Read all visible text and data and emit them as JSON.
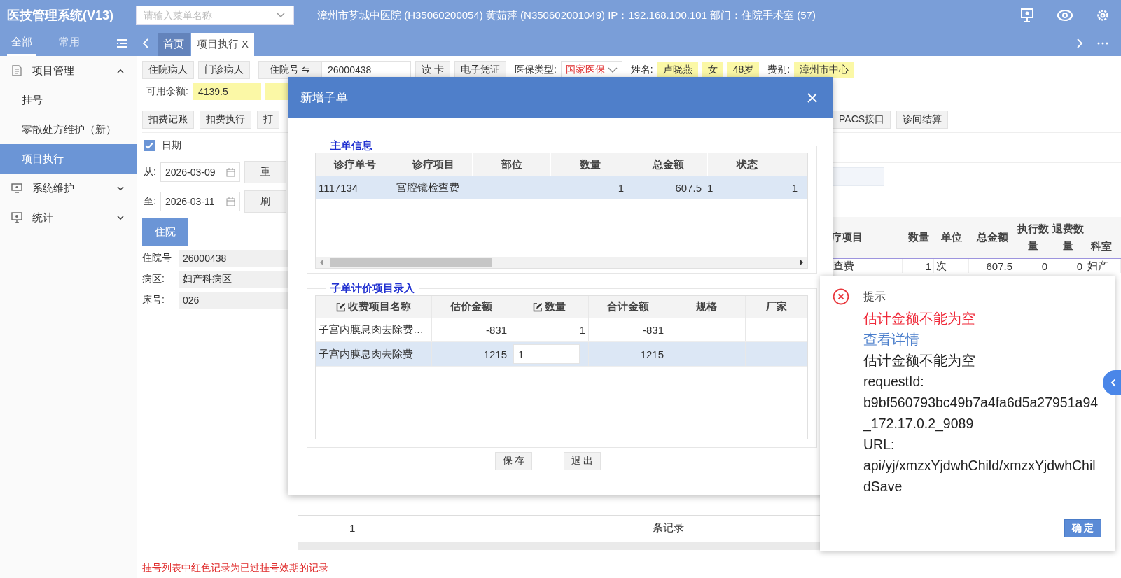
{
  "app": {
    "title": "医技管理系统(V13)",
    "menu_search": {
      "placeholder": "请输入菜单名称"
    },
    "user_info": "漳州市芗城中医院 (H35060200054) 黄茹萍 (N350602001049) IP：192.168.100.101 部门：住院手术室 (57)"
  },
  "nav_tabs": [
    {
      "label": "全部",
      "selected": true
    },
    {
      "label": "常用",
      "selected": false
    }
  ],
  "page_tabs": [
    {
      "label": "首页",
      "selected": false
    },
    {
      "label": "项目执行",
      "selected": true,
      "close": "X"
    }
  ],
  "sidebar": {
    "items": [
      {
        "label": "项目管理",
        "expanded": true,
        "children": [
          {
            "label": "挂号",
            "selected": false
          },
          {
            "label": "零散处方维护（新）",
            "selected": false
          },
          {
            "label": "项目执行",
            "selected": true
          }
        ]
      },
      {
        "label": "系统维护",
        "expanded": false
      },
      {
        "label": "统计",
        "expanded": false
      }
    ]
  },
  "patient_bar": {
    "type_buttons": [
      "住院病人",
      "门诊病人"
    ],
    "id_selector": "住院号 ⇋",
    "id_value": "26000438",
    "card_buttons": [
      "读 卡",
      "电子凭证"
    ],
    "insurance_label": "医保类型:",
    "insurance_value": "国家医保",
    "name_label": "姓名:",
    "patient_tags": [
      "卢晓燕",
      "女",
      "48岁"
    ],
    "fee_label": "费别:",
    "fee_value": "漳州市中心",
    "balance_label": "可用余额:",
    "balance_value": "4139.5"
  },
  "actions": {
    "left": [
      "扣费记账",
      "扣费执行",
      "打"
    ],
    "right": [
      "PACS接口",
      "诊间结算"
    ]
  },
  "filters": {
    "date_filter": {
      "label": "日期",
      "checked": true
    },
    "ranges": [
      {
        "label": "从:",
        "value": "2026-03-09",
        "button": "重"
      },
      {
        "label": "至:",
        "value": "2026-03-11",
        "button": "刷"
      }
    ]
  },
  "side_tab": "住院",
  "patient_fields": [
    {
      "label": "住院号",
      "value": "26000438"
    },
    {
      "label": "病区:",
      "value": "妇产科病区"
    },
    {
      "label": "床号:",
      "value": "026"
    }
  ],
  "orders_table": {
    "columns": [
      "疗项目",
      "数量",
      "单位",
      "总金额",
      "执行数量",
      "退费数量",
      "科室"
    ],
    "rows": [
      [
        "查费",
        "1",
        "次",
        "607.5",
        "0",
        "0",
        "妇产"
      ]
    ]
  },
  "pagination": {
    "page": "1",
    "records": "条记录"
  },
  "footer_note": "挂号列表中红色记录为已过挂号效期的记录",
  "dialog": {
    "title": "新增子单",
    "main": {
      "legend": "主单信息",
      "columns": [
        "诊疗单号",
        "诊疗项目",
        "部位",
        "数量",
        "总金额",
        "状态"
      ],
      "rows": [
        {
          "order_no": "1117134",
          "item": "宫腔镜检查费",
          "quantity": "1",
          "total": "607.5",
          "status": "1",
          "column_7": "1",
          "selected": true
        }
      ]
    },
    "sub": {
      "legend": "子单计价项目录入",
      "columns": [
        {
          "label": "收费项目名称",
          "editable": true
        },
        {
          "label": "估价金额",
          "editable": false
        },
        {
          "label": "数量",
          "editable": true
        },
        {
          "label": "合计金额",
          "editable": false
        },
        {
          "label": "规格",
          "editable": false
        },
        {
          "label": "厂家",
          "editable": false
        }
      ],
      "rows": [
        {
          "name": "子宫内膜息肉去除费…",
          "price": "-831",
          "quantity": "1",
          "total": "-831",
          "selected": false,
          "editing": false
        },
        {
          "name": "子宫内膜息肉去除费",
          "price": "1215",
          "quantity": "1",
          "total": "1215",
          "selected": true,
          "editing": true
        }
      ]
    },
    "buttons": [
      "保 存",
      "退 出"
    ]
  },
  "alert": {
    "title": "提示",
    "error": "估计金额不能为空",
    "link": "查看详情",
    "lines": [
      "估计金额不能为空",
      "requestId:",
      "b9bf560793bc49b7a4fa6d5a27951a94_172.17.0.2_9089",
      "URL:",
      "api/yj/xmzxYjdwhChild/xmzxYjdwhChildSave"
    ],
    "button": "确 定"
  }
}
